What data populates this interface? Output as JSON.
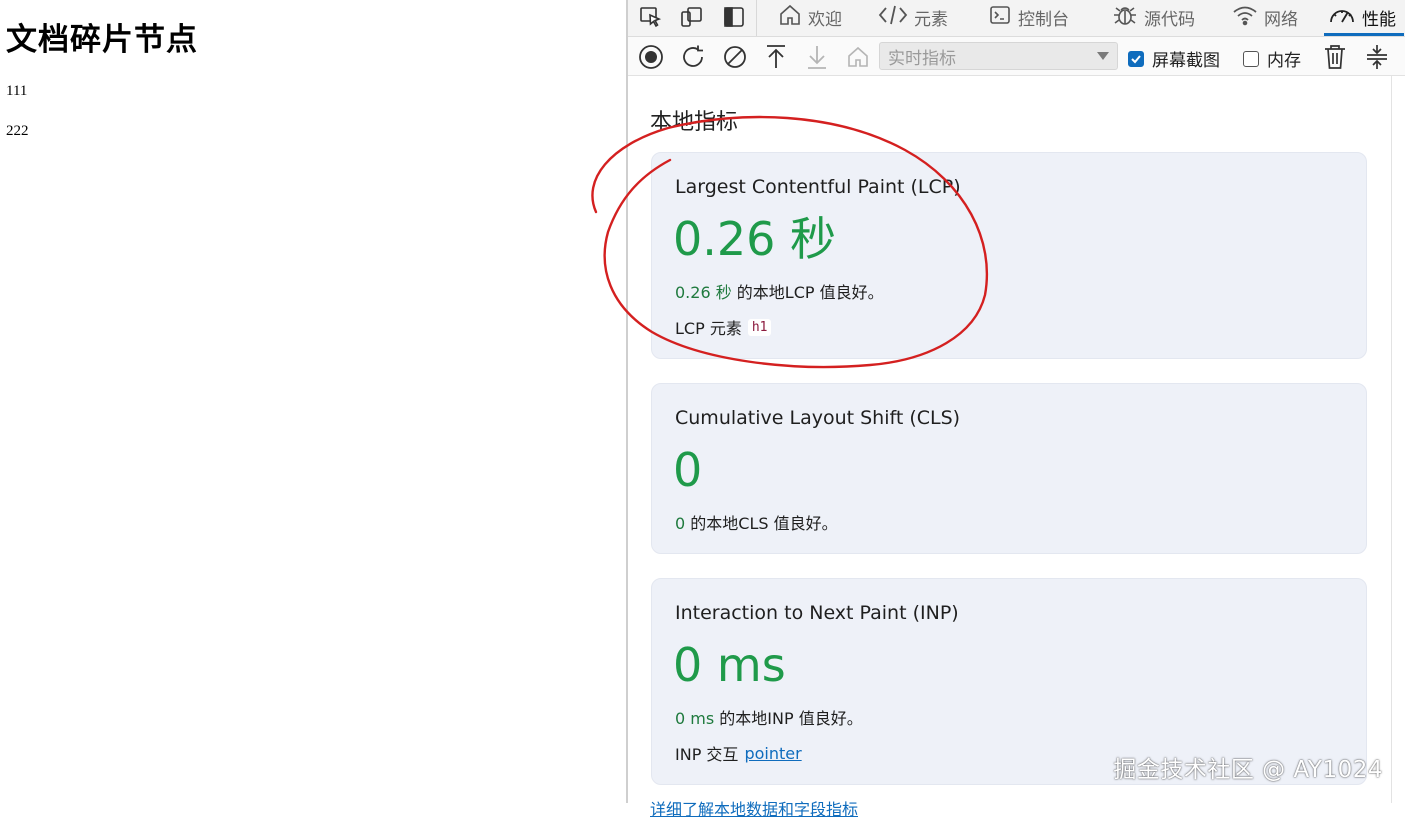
{
  "page": {
    "heading": "文档碎片节点",
    "paragraphs": [
      "111",
      "222"
    ]
  },
  "devtools": {
    "tabs": [
      {
        "label": "欢迎",
        "icon": "home-icon"
      },
      {
        "label": "元素",
        "icon": "code-icon"
      },
      {
        "label": "控制台",
        "icon": "console-icon"
      },
      {
        "label": "源代码",
        "icon": "bug-icon"
      },
      {
        "label": "网络",
        "icon": "wifi-icon"
      },
      {
        "label": "性能",
        "icon": "gauge-icon",
        "active": true
      }
    ],
    "toolbar": {
      "select_value": "实时指标",
      "screenshot_label": "屏幕截图",
      "screenshot_checked": true,
      "memory_label": "内存",
      "memory_checked": false
    },
    "section_title": "本地指标",
    "metrics": [
      {
        "title": "Largest Contentful Paint (LCP)",
        "value": "0.26 秒",
        "desc_value": "0.26 秒",
        "desc_text": " 的本地LCP 值良好。",
        "extra_label": "LCP 元素",
        "extra_code": "h1"
      },
      {
        "title": "Cumulative Layout Shift (CLS)",
        "value": "0",
        "desc_value": "0",
        "desc_text": " 的本地CLS 值良好。"
      },
      {
        "title": "Interaction to Next Paint (INP)",
        "value": "0 ms",
        "desc_value": "0 ms",
        "desc_text": " 的本地INP 值良好。",
        "extra_label": "INP 交互",
        "extra_link": "pointer"
      }
    ],
    "footer_link": "详细了解本地数据和字段指标"
  },
  "watermark": "掘金技术社区 @ AY1024",
  "colors": {
    "good": "#1f9a4a",
    "accent": "#0f6cbd",
    "annotation": "#d42020"
  }
}
